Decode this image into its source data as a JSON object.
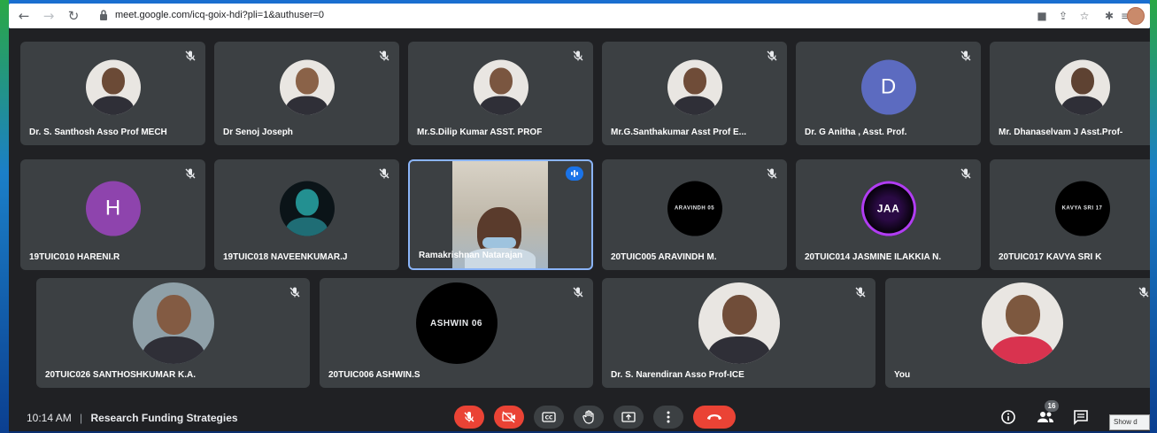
{
  "browser": {
    "url": "meet.google.com/icq-goix-hdi?pli=1&authuser=0"
  },
  "tiles": [
    {
      "name": "Dr. S. Santhosh Asso Prof MECH",
      "avatar": "photo"
    },
    {
      "name": "Dr Senoj Joseph",
      "avatar": "photo"
    },
    {
      "name": "Mr.S.Dilip Kumar ASST. PROF",
      "avatar": "photo"
    },
    {
      "name": "Mr.G.Santhakumar Asst Prof E...",
      "avatar": "photo"
    },
    {
      "name": "Dr. G Anitha , Asst. Prof.",
      "avatar": "letter",
      "letter": "D",
      "color": "#5c6bc0"
    },
    {
      "name": "Mr. Dhanaselvam J Asst.Prof-",
      "avatar": "photo"
    },
    {
      "name": "19TUIC010 HARENI.R",
      "avatar": "letter",
      "letter": "H",
      "color": "#8e44ad"
    },
    {
      "name": "19TUIC018 NAVEENKUMAR.J",
      "avatar": "photo"
    },
    {
      "name": "Ramakrishnan Natarajan",
      "avatar": "video"
    },
    {
      "name": "20TUIC005 ARAVINDH M.",
      "avatar": "logo",
      "logo_text": "ARAVINDH 05"
    },
    {
      "name": "20TUIC014 JASMINE ILAKKIA N.",
      "avatar": "logo",
      "logo_text": "JAA"
    },
    {
      "name": "20TUIC017 KAVYA SRI K",
      "avatar": "logo",
      "logo_text": "KAVYA SRI 17"
    },
    {
      "name": "20TUIC026 SANTHOSHKUMAR K.A.",
      "avatar": "photo"
    },
    {
      "name": "20TUIC006 ASHWIN.S",
      "avatar": "logo",
      "logo_text": "ASHWIN 06"
    },
    {
      "name": "Dr. S. Narendiran Asso Prof-ICE",
      "avatar": "photo"
    },
    {
      "name": "You",
      "avatar": "photo"
    }
  ],
  "footer": {
    "time": "10:14 AM",
    "separator": "|",
    "meeting_title": "Research Funding Strategies",
    "participant_count": "16",
    "tooltip": "Show d"
  },
  "colors": {
    "end_call": "#ea4335",
    "tile_bg": "#3c4043",
    "meet_bg": "#202124",
    "speaking": "#1a73e8"
  }
}
